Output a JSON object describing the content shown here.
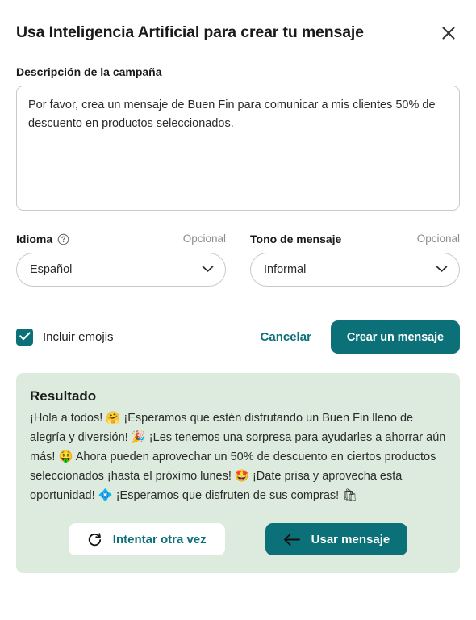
{
  "modal": {
    "title": "Usa Inteligencia Artificial para crear tu mensaje",
    "close_icon": "close-icon"
  },
  "description_field": {
    "label": "Descripción de la campaña",
    "value": "Por favor, crea un mensaje de Buen Fin para comunicar a mis clientes 50% de descuento en productos seleccionados.",
    "placeholder": ""
  },
  "language_field": {
    "label": "Idioma",
    "help_icon": "help-circle-icon",
    "optional_tag": "Opcional",
    "selected": "Español",
    "options": [
      "Español"
    ],
    "chevron_icon": "chevron-down-icon"
  },
  "tone_field": {
    "label": "Tono de mensaje",
    "optional_tag": "Opcional",
    "selected": "Informal",
    "options": [
      "Informal"
    ],
    "chevron_icon": "chevron-down-icon"
  },
  "actions": {
    "emoji_checkbox_label": "Incluir emojis",
    "emoji_checkbox_checked": true,
    "check_icon": "check-icon",
    "cancel_label": "Cancelar",
    "create_label": "Crear un mensaje"
  },
  "result": {
    "title": "Resultado",
    "text": "¡Hola a todos! 🤗 ¡Esperamos que estén disfrutando un Buen Fin lleno de alegría y diversión! 🎉 ¡Les tenemos una sorpresa para ayudarles a ahorrar aún más! 🤑 Ahora pueden aprovechar un 50% de descuento en ciertos productos seleccionados ¡hasta el próximo lunes! 🤩 ¡Date prisa y aprovecha esta oportunidad! 💠 ¡Esperamos que disfruten de sus compras! 🛍",
    "retry_label": "Intentar otra vez",
    "retry_icon": "refresh-icon",
    "use_label": "Usar mensaje",
    "use_icon": "arrow-left-icon"
  },
  "colors": {
    "accent": "#0b7077",
    "result_panel_bg": "#dcebdd",
    "text": "#1f1f1f",
    "muted": "#8c8c8c",
    "border": "#c9c9c9"
  }
}
